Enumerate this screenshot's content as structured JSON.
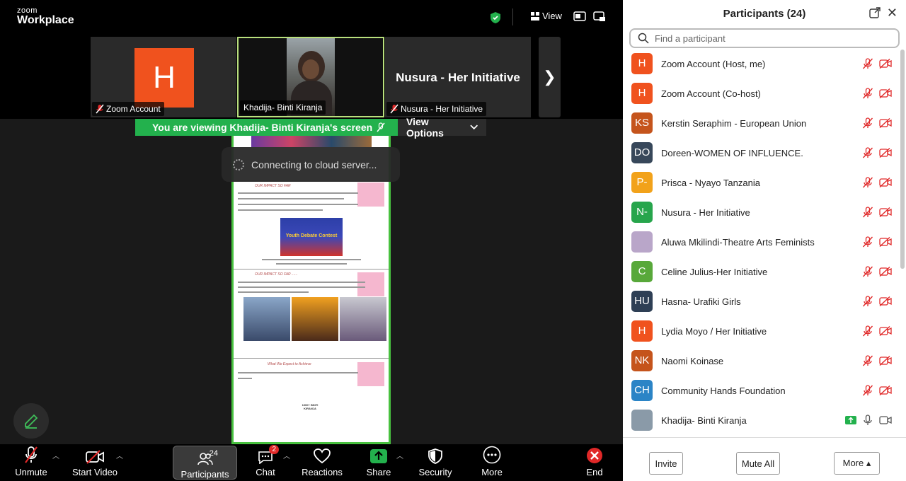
{
  "app": {
    "logo_line1": "zoom",
    "logo_line2": "Workplace",
    "view_label": "View"
  },
  "tiles": [
    {
      "initial": "H",
      "name": "Zoom Account"
    },
    {
      "name": "Khadija- Binti Kiranja"
    },
    {
      "big_name": "Nusura - Her Initiative",
      "name": "Nusura - Her Initiative"
    }
  ],
  "share": {
    "viewing_text": "You are viewing  Khadija- Binti Kiranja's screen",
    "view_options": "View Options",
    "toast": "Connecting to cloud server...",
    "doc": {
      "title1": "OUR IMPACT SO FAR",
      "banner": "Youth Debate Contest",
      "title2": "OUR IMPACT SO FAR ......",
      "title3": "What We Expect to Achieve",
      "center_label": "1000+ BINTI KIRANJA"
    }
  },
  "toolbar": {
    "unmute": "Unmute",
    "start_video": "Start Video",
    "participants": "Participants",
    "participants_count": "24",
    "chat": "Chat",
    "chat_badge": "2",
    "reactions": "Reactions",
    "share": "Share",
    "security": "Security",
    "more": "More",
    "end": "End"
  },
  "panel": {
    "title": "Participants (24)",
    "search_placeholder": "Find a participant",
    "participants": [
      {
        "initials": "H",
        "name": "Zoom Account (Host, me)",
        "color": "#f0521e"
      },
      {
        "initials": "H",
        "name": "Zoom Account (Co-host)",
        "color": "#f0521e"
      },
      {
        "initials": "KS",
        "name": "Kerstin Seraphim - European Union",
        "color": "#c5541c"
      },
      {
        "initials": "DO",
        "name": "Doreen-WOMEN OF INFLUENCE.",
        "color": "#37475a"
      },
      {
        "initials": "P-",
        "name": "Prisca - Nyayo Tanzania",
        "color": "#f2a21a"
      },
      {
        "initials": "N-",
        "name": "Nusura - Her Initiative",
        "color": "#27a54c"
      },
      {
        "initials": "",
        "name": "Aluwa Mkilindi-Theatre Arts Feminists",
        "color": "#b9a6c9"
      },
      {
        "initials": "C",
        "name": "Celine Julius-Her Initiative",
        "color": "#58a83a"
      },
      {
        "initials": "HU",
        "name": "Hasna- Urafiki Girls",
        "color": "#2e3f55"
      },
      {
        "initials": "H",
        "name": "Lydia Moyo / Her Initiative",
        "color": "#f0521e"
      },
      {
        "initials": "NK",
        "name": "Naomi Koinase",
        "color": "#c5541c"
      },
      {
        "initials": "CH",
        "name": "Community Hands Foundation",
        "color": "#2b84c6"
      },
      {
        "initials": "",
        "name": "Khadija- Binti Kiranja",
        "color": "#8a9aa8"
      }
    ],
    "invite": "Invite",
    "mute_all": "Mute All",
    "more": "More"
  }
}
